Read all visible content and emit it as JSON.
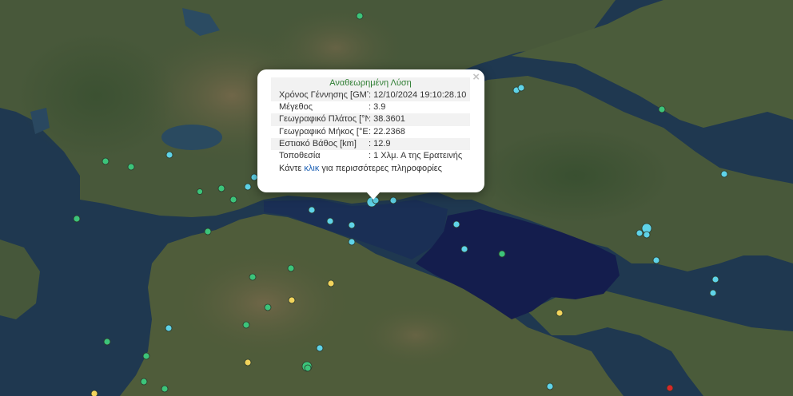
{
  "popup": {
    "close_symbol": "×",
    "title": "Αναθεωρημένη Λύση",
    "rows": [
      {
        "label": "Χρόνος Γέννησης [GMT]",
        "value": ": 12/10/2024 19:10:28.10"
      },
      {
        "label": "Μέγεθος",
        "value": ": 3.9"
      },
      {
        "label": "Γεωγραφικό Πλάτος [°N]",
        "value": ": 38.3601"
      },
      {
        "label": "Γεωγραφικό Μήκος [°E]",
        "value": ": 22.2368"
      },
      {
        "label": "Εστιακό Βάθος [km]",
        "value": ": 12.9"
      },
      {
        "label": "Τοποθεσία",
        "value": ": 1 Χλμ. Α της Ερατεινής"
      }
    ],
    "more_prefix": "Κάντε ",
    "more_link": "κλικ",
    "more_suffix": " για περισσότερες πληροφορίες"
  },
  "legend_colors": {
    "recent": "#d62828",
    "last_day": "#f2d45c",
    "last_week": "#5fd3e8",
    "older": "#3cc47a",
    "sea": "#1f3850",
    "gulf": "#111a4a",
    "land": "#46583a",
    "mountains": "#6e6447",
    "popup_title": "#2e7d32",
    "link": "#1a5fb4"
  }
}
